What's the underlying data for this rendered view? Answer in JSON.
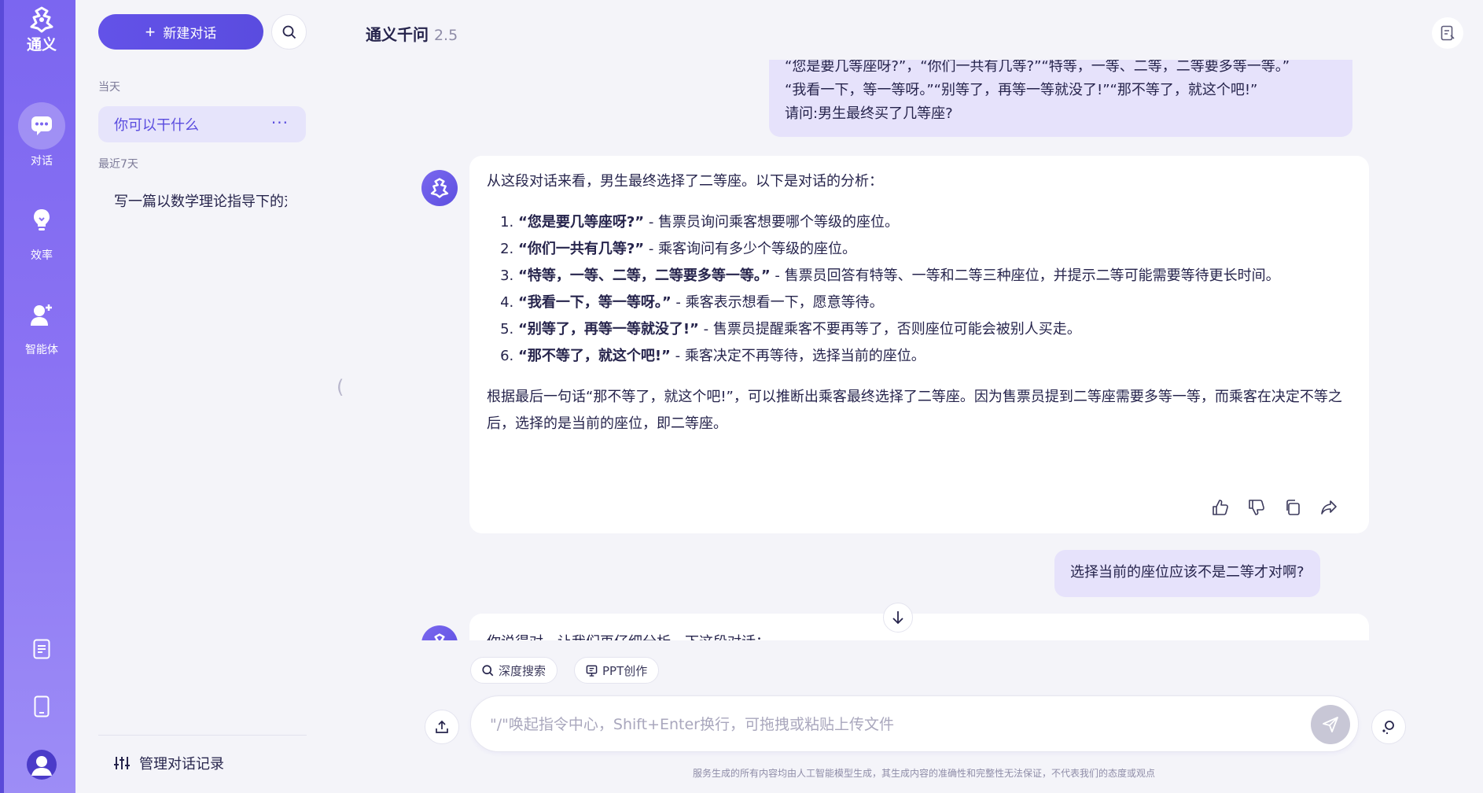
{
  "rail": {
    "brand": "通义",
    "items": [
      {
        "label": "对话",
        "icon": "chat-bubble-icon"
      },
      {
        "label": "效率",
        "icon": "lightbulb-icon"
      },
      {
        "label": "智能体",
        "icon": "agent-icon"
      }
    ]
  },
  "sidebar": {
    "new_chat": "新建对话",
    "today_label": "当天",
    "recent_label": "最近7天",
    "today_items": [
      "你可以干什么"
    ],
    "recent_items": [
      "写一篇以数学理论指导下的对"
    ],
    "more": "···",
    "manage": "管理对话记录"
  },
  "header": {
    "title": "通义千问",
    "version": "2.5"
  },
  "chat": {
    "user_msg_1": [
      "“您是要几等座呀?”，“你们一共有几等?”“特等，一等、二等，二等要多等一等。”",
      "“我看一下，等一等呀。”“别等了，再等一等就没了!”“那不等了，就这个吧!”",
      "请问:男生最终买了几等座?"
    ],
    "ai_reply_1": {
      "intro": "从这段对话来看，男生最终选择了二等座。以下是对话的分析：",
      "items": [
        {
          "q": "“您是要几等座呀?”",
          "a": " - 售票员询问乘客想要哪个等级的座位。"
        },
        {
          "q": "“你们一共有几等?”",
          "a": " - 乘客询问有多少个等级的座位。"
        },
        {
          "q": "“特等，一等、二等，二等要多等一等。”",
          "a": " - 售票员回答有特等、一等和二等三种座位，并提示二等可能需要等待更长时间。"
        },
        {
          "q": "“我看一下，等一等呀。”",
          "a": " - 乘客表示想看一下，愿意等待。"
        },
        {
          "q": "“别等了，再等一等就没了!”",
          "a": " - 售票员提醒乘客不要再等了，否则座位可能会被别人买走。"
        },
        {
          "q": "“那不等了，就这个吧!”",
          "a": " - 乘客决定不再等待，选择当前的座位。"
        }
      ],
      "conclusion": "根据最后一句话“那不等了，就这个吧!”，可以推断出乘客最终选择了二等座。因为售票员提到二等座需要多等一等，而乘客在决定不等之后，选择的是当前的座位，即二等座。"
    },
    "user_msg_2": "选择当前的座位应该不是二等才对啊?",
    "ai_reply_2_partial": "你说得对，让我们再仔细分析一下这段对话："
  },
  "input": {
    "chip_deep_search": "深度搜索",
    "chip_ppt": "PPT创作",
    "placeholder": "\"/\"唤起指令中心，Shift+Enter换行，可拖拽或粘贴上传文件"
  },
  "footer": {
    "disclaimer": "服务生成的所有内容均由人工智能模型生成，其生成内容的准确性和完整性无法保证，不代表我们的态度或观点"
  },
  "colors": {
    "accent": "#5a4cdf",
    "user_bubble": "#e6e2fb",
    "rail_gradient_top": "#7b66f0"
  }
}
